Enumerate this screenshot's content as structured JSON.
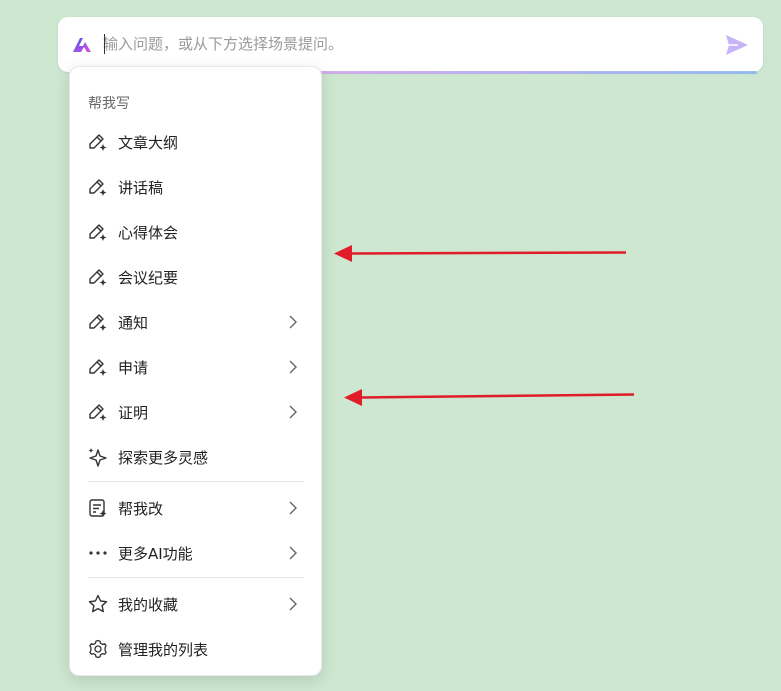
{
  "search": {
    "placeholder": "输入问题，或从下方选择场景提问。"
  },
  "menu": {
    "section_title": "帮我写",
    "write_items": [
      {
        "label": "文章大纲",
        "has_submenu": false
      },
      {
        "label": "讲话稿",
        "has_submenu": false
      },
      {
        "label": "心得体会",
        "has_submenu": false
      },
      {
        "label": "会议纪要",
        "has_submenu": false
      },
      {
        "label": "通知",
        "has_submenu": true
      },
      {
        "label": "申请",
        "has_submenu": true
      },
      {
        "label": "证明",
        "has_submenu": true
      }
    ],
    "explore_label": "探索更多灵感",
    "rewrite_label": "帮我改",
    "more_ai_label": "更多AI功能",
    "favorites_label": "我的收藏",
    "manage_label": "管理我的列表"
  },
  "colors": {
    "background": "#cde7d0",
    "logo_gradient": [
      "#3b5bfd",
      "#e24bd6"
    ],
    "send_icon": "#c7b3f7",
    "annotation_arrow": "#e11d2a"
  },
  "icons": {
    "logo": "ai-logo-icon",
    "send": "send-icon",
    "pen_sparkle": "pen-sparkle-icon",
    "sparkle": "sparkle-icon",
    "doc_edit": "document-edit-icon",
    "more": "more-dots-icon",
    "star": "star-icon",
    "gear": "gear-icon",
    "chevron": "chevron-right-icon"
  }
}
